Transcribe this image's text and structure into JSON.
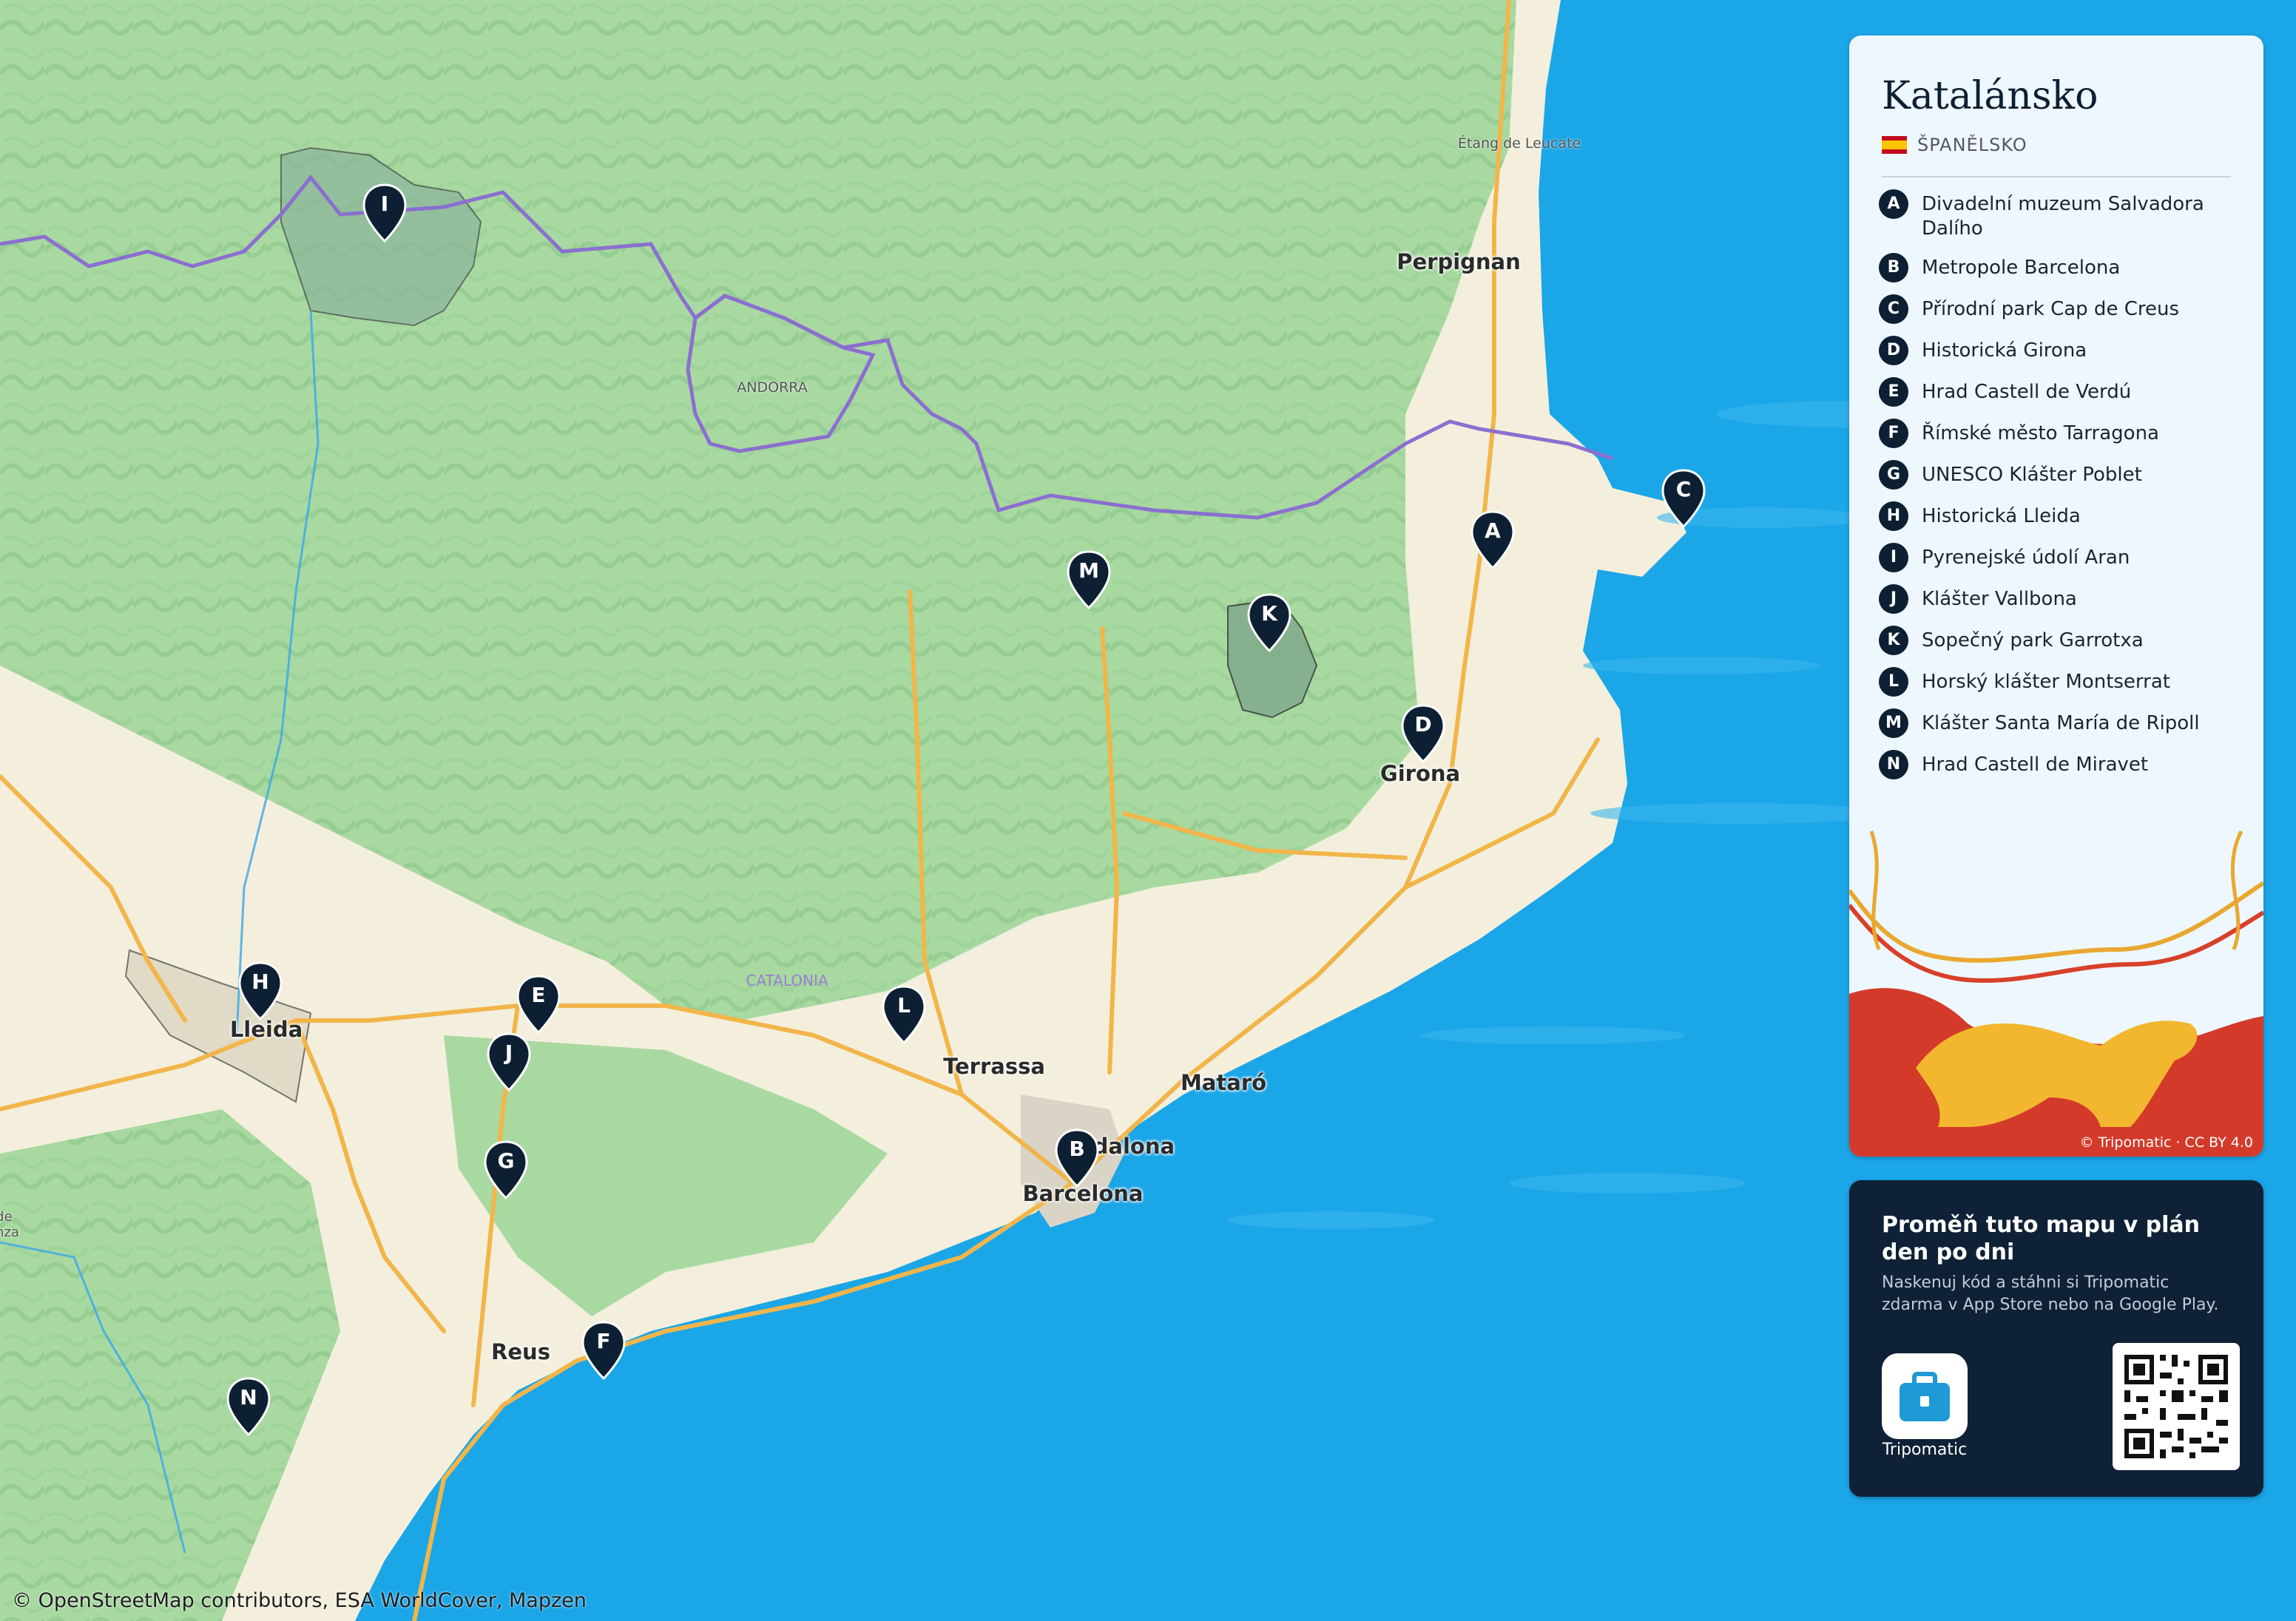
{
  "map": {
    "attribution": "© OpenStreetMap contributors, ESA WorldCover, Mapzen",
    "cities": [
      {
        "name": "Perpignan"
      },
      {
        "name": "Girona"
      },
      {
        "name": "Lleida"
      },
      {
        "name": "Terrassa"
      },
      {
        "name": "Mataró"
      },
      {
        "name": "Badalona"
      },
      {
        "name": "Barcelona"
      },
      {
        "name": "Reus"
      }
    ],
    "minor_labels": [
      {
        "name": "Étang de Leucate"
      },
      {
        "name": "ANDORRA"
      }
    ],
    "region_label": "CATALONIA",
    "edge_label": "de\nnza",
    "markers": [
      {
        "letter": "A"
      },
      {
        "letter": "B"
      },
      {
        "letter": "C"
      },
      {
        "letter": "D"
      },
      {
        "letter": "E"
      },
      {
        "letter": "F"
      },
      {
        "letter": "G"
      },
      {
        "letter": "H"
      },
      {
        "letter": "I"
      },
      {
        "letter": "J"
      },
      {
        "letter": "K"
      },
      {
        "letter": "L"
      },
      {
        "letter": "M"
      },
      {
        "letter": "N"
      }
    ]
  },
  "panel": {
    "title": "Katalánsko",
    "country": "ŠPANĚLSKO",
    "items": [
      {
        "letter": "A",
        "label": "Divadelní muzeum Salvadora Dalího"
      },
      {
        "letter": "B",
        "label": "Metropole Barcelona"
      },
      {
        "letter": "C",
        "label": "Přírodní park Cap de Creus"
      },
      {
        "letter": "D",
        "label": "Historická Girona"
      },
      {
        "letter": "E",
        "label": "Hrad Castell de Verdú"
      },
      {
        "letter": "F",
        "label": "Římské město Tarragona"
      },
      {
        "letter": "G",
        "label": "UNESCO Klášter Poblet"
      },
      {
        "letter": "H",
        "label": "Historická Lleida"
      },
      {
        "letter": "I",
        "label": "Pyrenejské údolí Aran"
      },
      {
        "letter": "J",
        "label": "Klášter Vallbona"
      },
      {
        "letter": "K",
        "label": "Sopečný park Garrotxa"
      },
      {
        "letter": "L",
        "label": "Horský klášter Montserrat"
      },
      {
        "letter": "M",
        "label": "Klášter Santa María de Ripoll"
      },
      {
        "letter": "N",
        "label": "Hrad Castell de Miravet"
      }
    ],
    "credit": "© Tripomatic · CC BY 4.0"
  },
  "promo": {
    "heading": "Proměň tuto mapu v plán den po dni",
    "text": "Naskenuj kód a stáhni si Tripomatic zdarma v App Store nebo na Google Play.",
    "app_name": "Tripomatic"
  },
  "colors": {
    "sea": "#1ba6e8",
    "land": "#f3efdc",
    "forest": "#a8d9a1",
    "road": "#f2b54a",
    "border": "#8b6fd0",
    "marker": "#0d1f33"
  }
}
